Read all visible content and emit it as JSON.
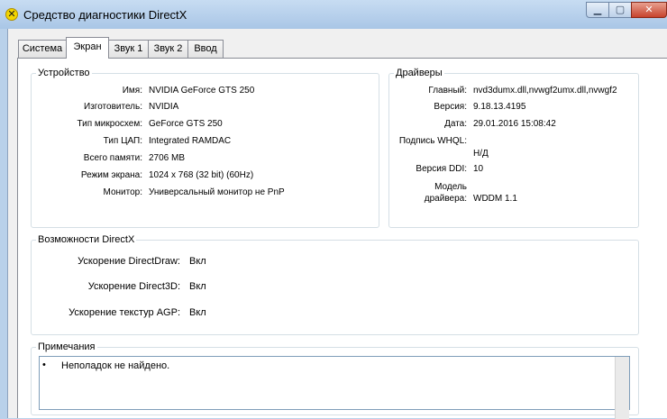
{
  "window": {
    "title": "Средство диагностики DirectX",
    "icon": "directx-icon"
  },
  "tabs": [
    {
      "label": "Система"
    },
    {
      "label": "Экран",
      "active": true
    },
    {
      "label": "Звук 1"
    },
    {
      "label": "Звук 2"
    },
    {
      "label": "Ввод"
    }
  ],
  "device": {
    "title": "Устройство",
    "rows": [
      {
        "label": "Имя:",
        "value": "NVIDIA GeForce GTS 250"
      },
      {
        "label": "Изготовитель:",
        "value": "NVIDIA"
      },
      {
        "label": "Тип микросхем:",
        "value": "GeForce GTS 250"
      },
      {
        "label": "Тип ЦАП:",
        "value": "Integrated RAMDAC"
      },
      {
        "label": "Всего памяти:",
        "value": "2706 MB"
      },
      {
        "label": "Режим экрана:",
        "value": "1024 x 768 (32 bit) (60Hz)"
      },
      {
        "label": "Монитор:",
        "value": "Универсальный монитор не PnP"
      }
    ]
  },
  "drivers": {
    "title": "Драйверы",
    "main_label": "Главный:",
    "main_value": "nvd3dumx.dll,nvwgf2umx.dll,nvwgf2",
    "version_label": "Версия:",
    "version_value": "9.18.13.4195",
    "date_label": "Дата:",
    "date_value": "29.01.2016 15:08:42",
    "whql_label": "Подпись WHQL:",
    "whql_value": "Н/Д",
    "ddi_label": "Версия DDI:",
    "ddi_value": "10",
    "model_label_1": "Модель",
    "model_label_2": "драйвера:",
    "model_value": "WDDM 1.1"
  },
  "features": {
    "title": "Возможности DirectX",
    "rows": [
      {
        "label": "Ускорение DirectDraw:",
        "value": "Вкл"
      },
      {
        "label": "Ускорение Direct3D:",
        "value": "Вкл"
      },
      {
        "label": "Ускорение текстур AGP:",
        "value": "Вкл"
      }
    ]
  },
  "notes": {
    "title": "Примечания",
    "bullet": "•",
    "text": "Неполадок не найдено."
  }
}
